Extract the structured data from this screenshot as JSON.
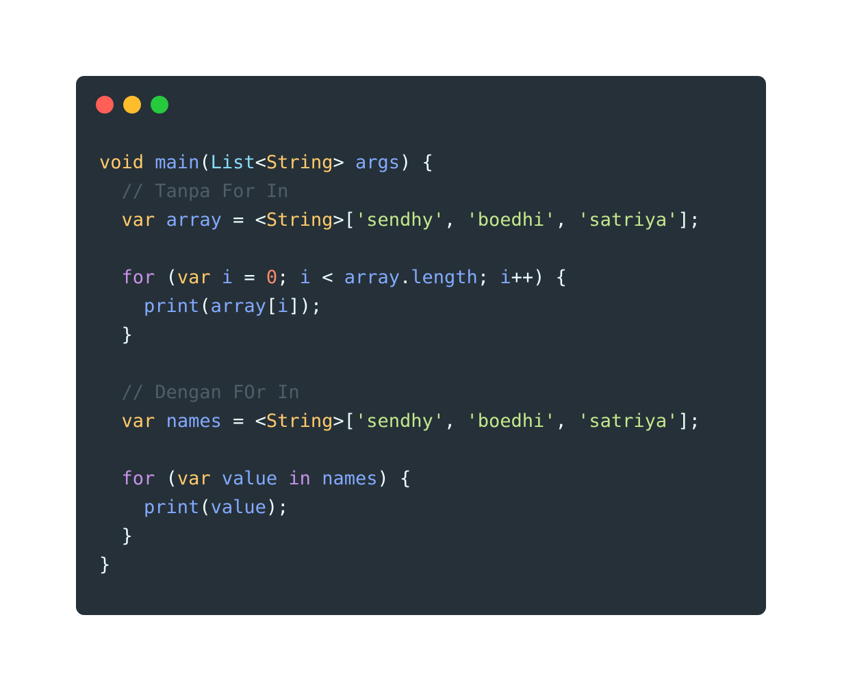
{
  "window": {
    "controls": [
      {
        "name": "close-button",
        "color": "#ff5f56"
      },
      {
        "name": "minimize-button",
        "color": "#ffbd2e"
      },
      {
        "name": "maximize-button",
        "color": "#27c93f"
      }
    ]
  },
  "colors": {
    "background": "#263038",
    "keyword": "#c792ea",
    "type": "#ffcb6b",
    "function": "#82aaff",
    "string": "#c3e88d",
    "number": "#f78c6c",
    "comment": "#4f5e68",
    "plain": "#eeffff"
  },
  "code": {
    "lines": [
      [
        {
          "t": "type",
          "v": "void"
        },
        {
          "t": "plain",
          "v": " "
        },
        {
          "t": "fn",
          "v": "main"
        },
        {
          "t": "punct",
          "v": "("
        },
        {
          "t": "cls",
          "v": "List"
        },
        {
          "t": "punct",
          "v": "<"
        },
        {
          "t": "type",
          "v": "String"
        },
        {
          "t": "punct",
          "v": "> "
        },
        {
          "t": "id",
          "v": "args"
        },
        {
          "t": "punct",
          "v": ") {"
        }
      ],
      [
        {
          "t": "plain",
          "v": "  "
        },
        {
          "t": "cm",
          "v": "// Tanpa For In"
        }
      ],
      [
        {
          "t": "plain",
          "v": "  "
        },
        {
          "t": "type",
          "v": "var"
        },
        {
          "t": "plain",
          "v": " "
        },
        {
          "t": "id",
          "v": "array"
        },
        {
          "t": "punct",
          "v": " = <"
        },
        {
          "t": "type",
          "v": "String"
        },
        {
          "t": "punct",
          "v": ">["
        },
        {
          "t": "str",
          "v": "'sendhy'"
        },
        {
          "t": "punct",
          "v": ", "
        },
        {
          "t": "str",
          "v": "'boedhi'"
        },
        {
          "t": "punct",
          "v": ", "
        },
        {
          "t": "str",
          "v": "'satriya'"
        },
        {
          "t": "punct",
          "v": "];"
        }
      ],
      [],
      [
        {
          "t": "plain",
          "v": "  "
        },
        {
          "t": "kw",
          "v": "for"
        },
        {
          "t": "punct",
          "v": " ("
        },
        {
          "t": "type",
          "v": "var"
        },
        {
          "t": "plain",
          "v": " "
        },
        {
          "t": "id",
          "v": "i"
        },
        {
          "t": "punct",
          "v": " = "
        },
        {
          "t": "num",
          "v": "0"
        },
        {
          "t": "punct",
          "v": "; "
        },
        {
          "t": "id",
          "v": "i"
        },
        {
          "t": "punct",
          "v": " < "
        },
        {
          "t": "id",
          "v": "array"
        },
        {
          "t": "punct",
          "v": "."
        },
        {
          "t": "id",
          "v": "length"
        },
        {
          "t": "punct",
          "v": "; "
        },
        {
          "t": "id",
          "v": "i"
        },
        {
          "t": "punct",
          "v": "++) {"
        }
      ],
      [
        {
          "t": "plain",
          "v": "    "
        },
        {
          "t": "fn",
          "v": "print"
        },
        {
          "t": "punct",
          "v": "("
        },
        {
          "t": "id",
          "v": "array"
        },
        {
          "t": "punct",
          "v": "["
        },
        {
          "t": "id",
          "v": "i"
        },
        {
          "t": "punct",
          "v": "]);"
        }
      ],
      [
        {
          "t": "plain",
          "v": "  "
        },
        {
          "t": "punct",
          "v": "}"
        }
      ],
      [],
      [
        {
          "t": "plain",
          "v": "  "
        },
        {
          "t": "cm",
          "v": "// Dengan FOr In"
        }
      ],
      [
        {
          "t": "plain",
          "v": "  "
        },
        {
          "t": "type",
          "v": "var"
        },
        {
          "t": "plain",
          "v": " "
        },
        {
          "t": "id",
          "v": "names"
        },
        {
          "t": "punct",
          "v": " = <"
        },
        {
          "t": "type",
          "v": "String"
        },
        {
          "t": "punct",
          "v": ">["
        },
        {
          "t": "str",
          "v": "'sendhy'"
        },
        {
          "t": "punct",
          "v": ", "
        },
        {
          "t": "str",
          "v": "'boedhi'"
        },
        {
          "t": "punct",
          "v": ", "
        },
        {
          "t": "str",
          "v": "'satriya'"
        },
        {
          "t": "punct",
          "v": "];"
        }
      ],
      [],
      [
        {
          "t": "plain",
          "v": "  "
        },
        {
          "t": "kw",
          "v": "for"
        },
        {
          "t": "punct",
          "v": " ("
        },
        {
          "t": "type",
          "v": "var"
        },
        {
          "t": "plain",
          "v": " "
        },
        {
          "t": "id",
          "v": "value"
        },
        {
          "t": "plain",
          "v": " "
        },
        {
          "t": "kw",
          "v": "in"
        },
        {
          "t": "plain",
          "v": " "
        },
        {
          "t": "id",
          "v": "names"
        },
        {
          "t": "punct",
          "v": ") {"
        }
      ],
      [
        {
          "t": "plain",
          "v": "    "
        },
        {
          "t": "fn",
          "v": "print"
        },
        {
          "t": "punct",
          "v": "("
        },
        {
          "t": "id",
          "v": "value"
        },
        {
          "t": "punct",
          "v": ");"
        }
      ],
      [
        {
          "t": "plain",
          "v": "  "
        },
        {
          "t": "punct",
          "v": "}"
        }
      ],
      [
        {
          "t": "punct",
          "v": "}"
        }
      ]
    ]
  }
}
